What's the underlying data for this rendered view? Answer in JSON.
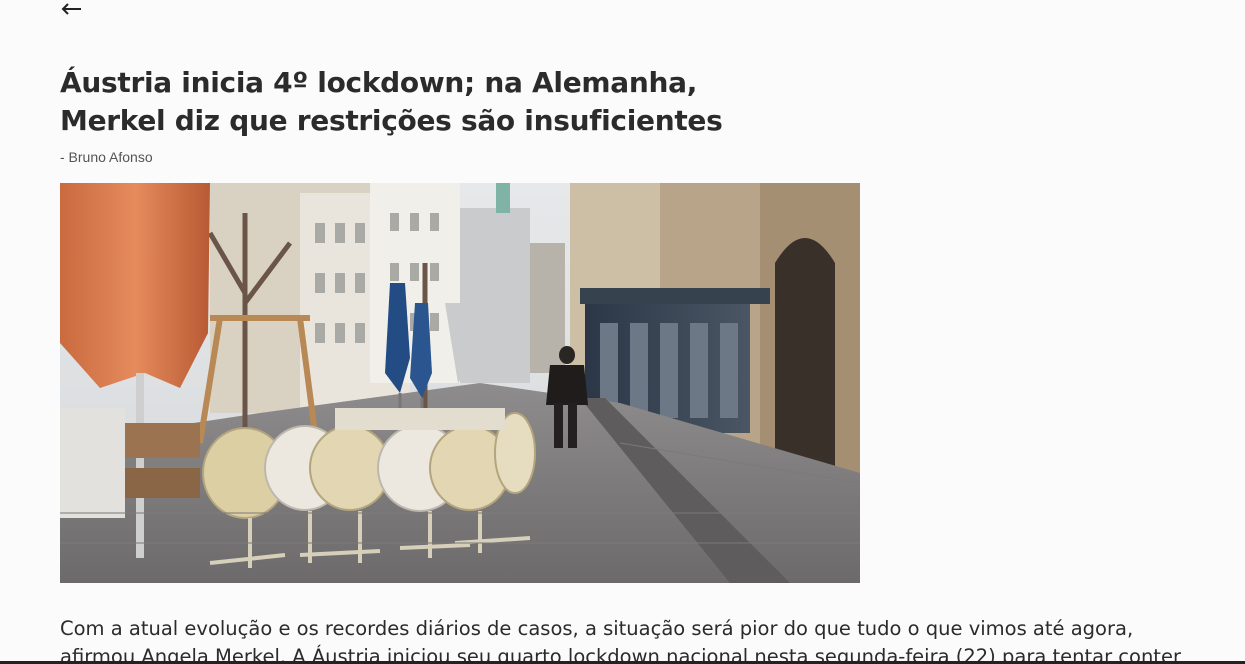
{
  "navigation": {
    "back_icon": "arrow-left-icon"
  },
  "article": {
    "title_line1": "Áustria inicia 4º lockdown; na Alemanha,",
    "title_line2": "Merkel diz que restrições são insuficientes",
    "byline": "- Bruno Afonso",
    "photo_alt": "Rua vazia em Viena com mesas de esplanada empilhadas e guarda-sóis fechados",
    "body_line1": "Com a atual evolução e os recordes diários de casos, a situação será pior do que tudo o que vimos até agora,",
    "body_line2": "afirmou Angela Merkel. A Áustria iniciou seu quarto lockdown nacional nesta segunda-feira (22) para tentar conter"
  },
  "colors": {
    "background": "#fbfbfb",
    "text": "#2b2b2b",
    "byline": "#555555"
  }
}
